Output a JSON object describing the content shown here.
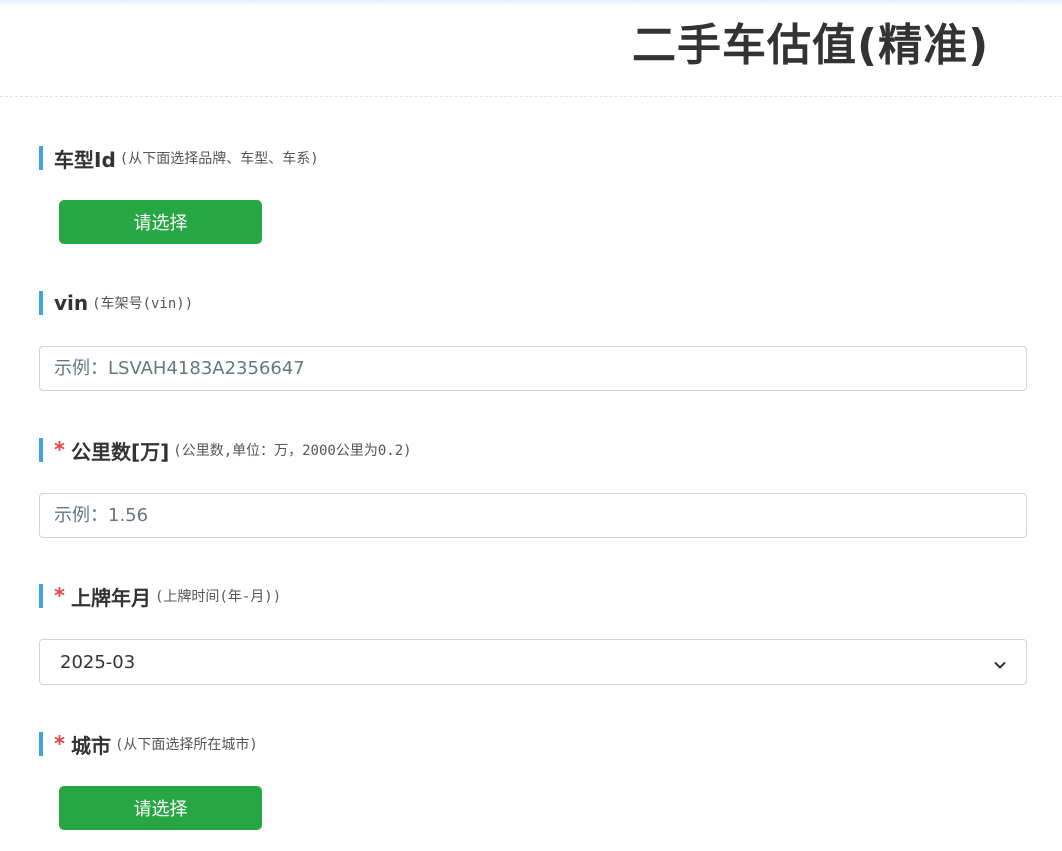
{
  "header": {
    "title": "二手车估值(精准)"
  },
  "fields": {
    "model_id": {
      "label": "车型Id",
      "hint": "(从下面选择品牌、车型、车系)",
      "button_label": "请选择"
    },
    "vin": {
      "label": "vin",
      "hint": "(车架号(vin))",
      "placeholder": "示例：LSVAH4183A2356647",
      "value": ""
    },
    "mileage": {
      "required_mark": "*",
      "label": "公里数[万]",
      "hint": "(公里数,单位：万，2000公里为0.2)",
      "placeholder": "示例：1.56",
      "value": ""
    },
    "reg_date": {
      "required_mark": "*",
      "label": "上牌年月",
      "hint": "(上牌时间(年-月))",
      "selected_value": "2025-03"
    },
    "city": {
      "required_mark": "*",
      "label": "城市",
      "hint": "(从下面选择所在城市)",
      "button_label": "请选择"
    }
  },
  "colors": {
    "accent_bar": "#3fa4e0",
    "button_green": "#27a744",
    "required_red": "#e54545"
  },
  "icons": {
    "select_arrow": "chevron-down-icon"
  }
}
